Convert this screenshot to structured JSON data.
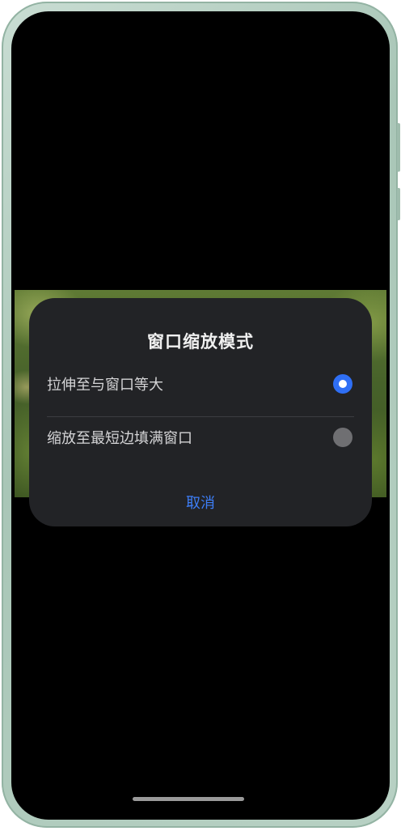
{
  "dialog": {
    "title": "窗口缩放模式",
    "options": [
      {
        "label": "拉伸至与窗口等大",
        "selected": true
      },
      {
        "label": "缩放至最短边填满窗口",
        "selected": false
      }
    ],
    "cancel_label": "取消"
  },
  "colors": {
    "accent": "#2f6ff5",
    "cancel_text": "#3d7ef7",
    "dialog_background": "#222326"
  }
}
